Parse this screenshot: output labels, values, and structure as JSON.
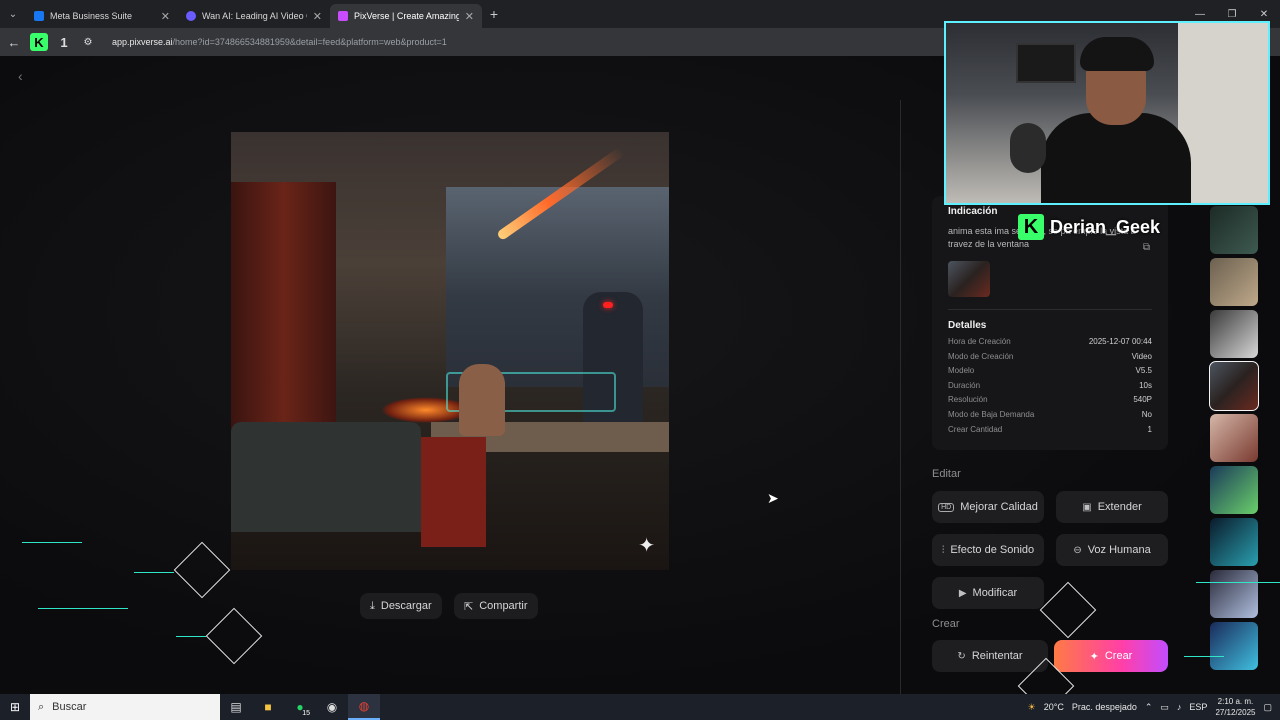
{
  "browser": {
    "tabs": [
      {
        "title": "Meta Business Suite",
        "color": "#1877f2"
      },
      {
        "title": "Wan AI: Leading AI Video Gene",
        "color": "#6a5cff"
      },
      {
        "title": "PixVerse | Create Amazing AI V",
        "color": "#c94cff"
      }
    ],
    "url_domain": "app.pixverse.ai",
    "url_path": "/home?id=374866534881959&detail=feed&platform=web&product=1"
  },
  "media_actions": {
    "download": "Descargar",
    "share": "Compartir"
  },
  "side_panel": {
    "prompt_title": "Indicación",
    "prompt_text": "anima esta ima sentada, se pa empie la vista a travez de la ventana",
    "details_title": "Detalles",
    "details": [
      {
        "label": "Hora de Creación",
        "value": "2025-12-07 00:44"
      },
      {
        "label": "Modo de Creación",
        "value": "Video"
      },
      {
        "label": "Modelo",
        "value": "V5.5"
      },
      {
        "label": "Duración",
        "value": "10s"
      },
      {
        "label": "Resolución",
        "value": "540P"
      },
      {
        "label": "Modo de Baja Demanda",
        "value": "No"
      },
      {
        "label": "Crear Cantidad",
        "value": "1"
      }
    ],
    "edit_label": "Editar",
    "tools": {
      "improve": "Mejorar Calidad",
      "extend": "Extender",
      "sound": "Efecto de Sonido",
      "voice": "Voz Humana",
      "modify": "Modificar"
    },
    "create_label": "Crear",
    "retry": "Reintentar",
    "create_button": "Crear"
  },
  "overlay": {
    "streamer_name": "Derian_Geek"
  },
  "taskbar": {
    "search_placeholder": "Buscar",
    "whatsapp_badge": "15",
    "weather": "20°C",
    "weather_text": "Prac. despejado",
    "lang": "ESP",
    "time": "2:10 a. m.",
    "date": "27/12/2025"
  }
}
